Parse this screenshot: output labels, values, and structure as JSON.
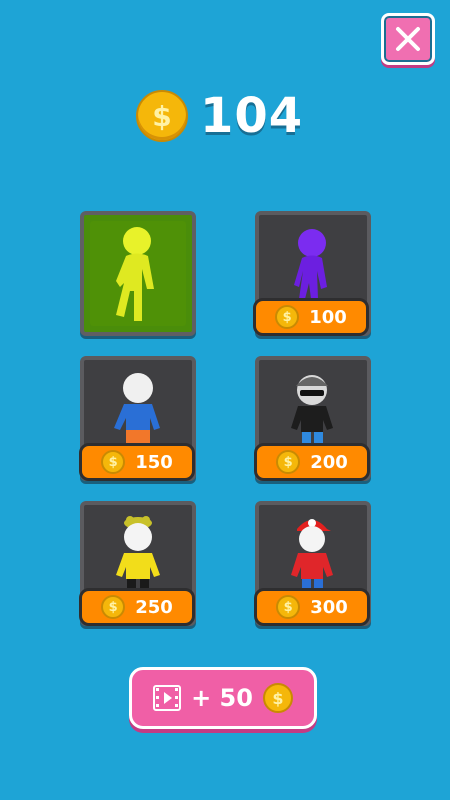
{
  "colors": {
    "background": "#1ea4d6",
    "accent": "#f06fb1",
    "price_tag": "#ff8a00"
  },
  "header": {
    "coins": "104",
    "coin_icon": "dollar-coin"
  },
  "close_button": {
    "icon": "close-x"
  },
  "shop": {
    "items": [
      {
        "label": "yellow-stickman",
        "price": "",
        "selected": true
      },
      {
        "label": "purple-stickman",
        "price": "100"
      },
      {
        "label": "white-head-blue-shirt",
        "price": "150"
      },
      {
        "label": "cap-sunglasses-black-shirt",
        "price": "200"
      },
      {
        "label": "frog-hat-yellow-shirt",
        "price": "250"
      },
      {
        "label": "red-cap-red-shirt",
        "price": "300"
      }
    ]
  },
  "ad_button": {
    "label": "+ 50",
    "icon": "video-icon"
  }
}
